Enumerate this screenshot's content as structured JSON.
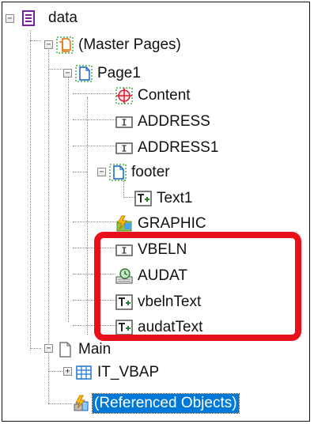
{
  "tree": {
    "root": {
      "label": "data",
      "icon": "data-node-icon"
    },
    "master_pages": {
      "label": "(Master Pages)",
      "icon": "master-pages-icon"
    },
    "page1": {
      "label": "Page1",
      "icon": "page-icon"
    },
    "content": {
      "label": "Content",
      "icon": "window-crosshair-icon"
    },
    "address": {
      "label": "ADDRESS",
      "icon": "address-icon"
    },
    "address1": {
      "label": "ADDRESS1",
      "icon": "address-icon"
    },
    "footer": {
      "label": "footer",
      "icon": "window-icon"
    },
    "text1": {
      "label": "Text1",
      "icon": "text-icon"
    },
    "graphic": {
      "label": "GRAPHIC",
      "icon": "graphic-icon"
    },
    "vbeln": {
      "label": "VBELN",
      "icon": "address-icon"
    },
    "audat": {
      "label": "AUDAT",
      "icon": "program-lines-icon"
    },
    "vbelntext": {
      "label": "vbelnText",
      "icon": "text-icon"
    },
    "audattext": {
      "label": "audatText",
      "icon": "text-icon"
    },
    "main": {
      "label": "Main",
      "icon": "main-window-icon"
    },
    "it_vbap": {
      "label": "IT_VBAP",
      "icon": "table-icon"
    },
    "referenced": {
      "label": "(Referenced Objects)",
      "icon": "referenced-objects-icon"
    }
  },
  "colors": {
    "highlight": "#e8111b",
    "selection": "#0078d7"
  }
}
